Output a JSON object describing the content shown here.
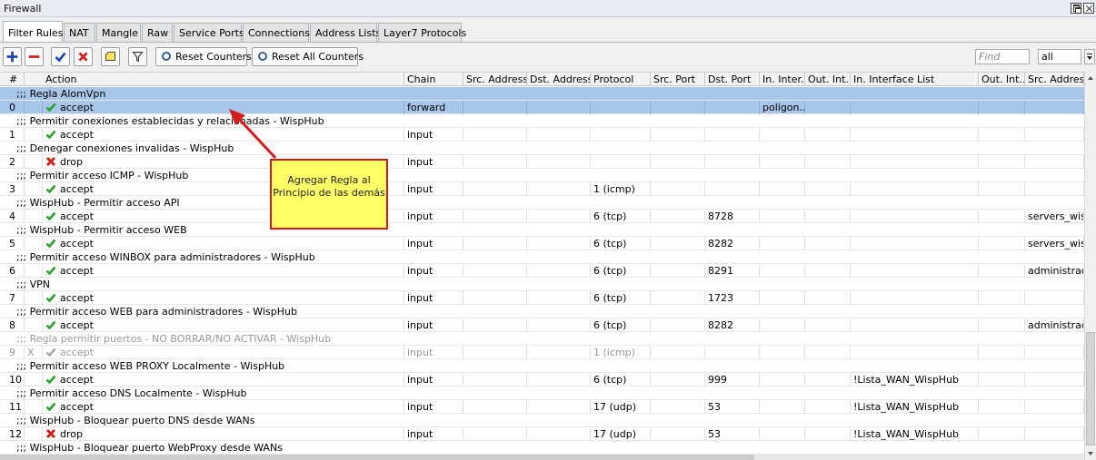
{
  "window": {
    "title": "Firewall"
  },
  "tabs": [
    "Filter Rules",
    "NAT",
    "Mangle",
    "Raw",
    "Service Ports",
    "Connections",
    "Address Lists",
    "Layer7 Protocols"
  ],
  "toolbar": {
    "reset_counters": "Reset Counters",
    "reset_all_counters": "Reset All Counters",
    "find_placeholder": "Find",
    "filter_value": "all"
  },
  "columns": [
    "#",
    "Action",
    "Chain",
    "Src. Address",
    "Dst. Address",
    "Protocol",
    "Src. Port",
    "Dst. Port",
    "In. Inter...",
    "Out. Int...",
    "In. Interface List",
    "Out. Int...",
    "Src. Address"
  ],
  "rows": [
    {
      "kind": "comment",
      "text": ";;; Regla AlomVpn",
      "selected": true
    },
    {
      "kind": "rule",
      "num": "0",
      "action": "accept",
      "chain": "forward",
      "protocol": "",
      "dst_port": "",
      "in_iface": "poligon...",
      "in_iface_list": "",
      "src_list": "",
      "selected": true
    },
    {
      "kind": "comment",
      "text": ";;; Permitir conexiones establecidas y relacionadas - WispHub"
    },
    {
      "kind": "rule",
      "num": "1",
      "action": "accept",
      "chain": "input",
      "protocol": "",
      "dst_port": "",
      "in_iface": "",
      "in_iface_list": "",
      "src_list": ""
    },
    {
      "kind": "comment",
      "text": ";;; Denegar conexiones invalidas - WispHub"
    },
    {
      "kind": "rule",
      "num": "2",
      "action": "drop",
      "chain": "input",
      "protocol": "",
      "dst_port": "",
      "in_iface": "",
      "in_iface_list": "",
      "src_list": ""
    },
    {
      "kind": "comment",
      "text": ";;; Permitir acceso ICMP - WispHub"
    },
    {
      "kind": "rule",
      "num": "3",
      "action": "accept",
      "chain": "input",
      "protocol": "1 (icmp)",
      "dst_port": "",
      "in_iface": "",
      "in_iface_list": "",
      "src_list": ""
    },
    {
      "kind": "comment",
      "text": ";;; WispHub - Permitir acceso API"
    },
    {
      "kind": "rule",
      "num": "4",
      "action": "accept",
      "chain": "input",
      "protocol": "6 (tcp)",
      "dst_port": "8728",
      "in_iface": "",
      "in_iface_list": "",
      "src_list": "servers_wisph"
    },
    {
      "kind": "comment",
      "text": ";;; WispHub - Permitir acceso WEB"
    },
    {
      "kind": "rule",
      "num": "5",
      "action": "accept",
      "chain": "input",
      "protocol": "6 (tcp)",
      "dst_port": "8282",
      "in_iface": "",
      "in_iface_list": "",
      "src_list": "servers_wisph"
    },
    {
      "kind": "comment",
      "text": ";;; Permitir acceso WINBOX para administradores - WispHub"
    },
    {
      "kind": "rule",
      "num": "6",
      "action": "accept",
      "chain": "input",
      "protocol": "6 (tcp)",
      "dst_port": "8291",
      "in_iface": "",
      "in_iface_list": "",
      "src_list": "administrador"
    },
    {
      "kind": "comment",
      "text": ";;; VPN"
    },
    {
      "kind": "rule",
      "num": "7",
      "action": "accept",
      "chain": "input",
      "protocol": "6 (tcp)",
      "dst_port": "1723",
      "in_iface": "",
      "in_iface_list": "",
      "src_list": ""
    },
    {
      "kind": "comment",
      "text": ";;; Permitir acceso WEB para administradores - WispHub"
    },
    {
      "kind": "rule",
      "num": "8",
      "action": "accept",
      "chain": "input",
      "protocol": "6 (tcp)",
      "dst_port": "8282",
      "in_iface": "",
      "in_iface_list": "",
      "src_list": "administrador"
    },
    {
      "kind": "comment",
      "text": ";;; Regla permitir puertos - NO BORRAR/NO ACTIVAR - WispHub",
      "disabled": true
    },
    {
      "kind": "rule",
      "num": "9",
      "flag": "X",
      "action": "accept",
      "chain": "input",
      "protocol": "1 (icmp)",
      "dst_port": "",
      "in_iface": "",
      "in_iface_list": "",
      "src_list": "",
      "disabled": true
    },
    {
      "kind": "comment",
      "text": ";;; Permitir acceso WEB PROXY Localmente - WispHub"
    },
    {
      "kind": "rule",
      "num": "10",
      "action": "accept",
      "chain": "input",
      "protocol": "6 (tcp)",
      "dst_port": "999",
      "in_iface": "",
      "in_iface_list": "!Lista_WAN_WispHub",
      "src_list": ""
    },
    {
      "kind": "comment",
      "text": ";;; Permitir acceso DNS Localmente - WispHub"
    },
    {
      "kind": "rule",
      "num": "11",
      "action": "accept",
      "chain": "input",
      "protocol": "17 (udp)",
      "dst_port": "53",
      "in_iface": "",
      "in_iface_list": "!Lista_WAN_WispHub",
      "src_list": ""
    },
    {
      "kind": "comment",
      "text": ";;; WispHub - Bloquear puerto DNS desde WANs"
    },
    {
      "kind": "rule",
      "num": "12",
      "action": "drop",
      "chain": "input",
      "protocol": "17 (udp)",
      "dst_port": "53",
      "in_iface": "",
      "in_iface_list": "!Lista_WAN_WispHub",
      "src_list": ""
    },
    {
      "kind": "comment",
      "text": ";;; WispHub - Bloquear puerto WebProxy desde WANs"
    }
  ],
  "annotation": {
    "text": "Agregar Regla al Principio de las demás"
  },
  "colors": {
    "accept": "#2e9e2e",
    "drop": "#cc2222",
    "selected_row": "#a8c5ea",
    "callout_bg": "#ffff66",
    "callout_border": "#d41c1c"
  }
}
